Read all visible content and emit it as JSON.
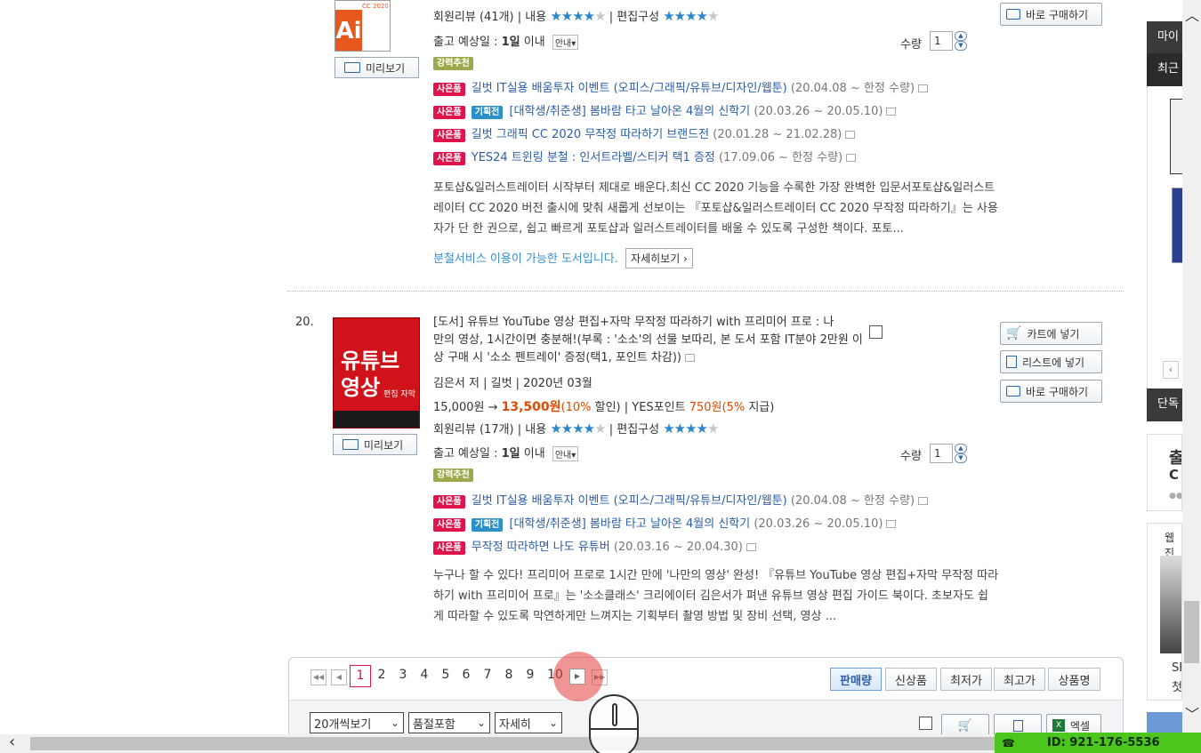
{
  "item19": {
    "review": "회원리뷰 (41개) | 내용",
    "edit_label": "| 편집구성",
    "ship": "출고 예상일 :",
    "ship_day": "1일",
    "ship_within": "이내",
    "guide": "안내▾",
    "qty_label": "수량",
    "qty_value": "1",
    "buy_now": "바로 구매하기",
    "preview": "미리보기",
    "strong": "강력추천",
    "gifts": [
      {
        "tags": [
          "사은품"
        ],
        "text": "길벗 IT실용 배움투자 이벤트 (오피스/그래픽/유튜브/디자인/웹툰)",
        "period": "(20.04.08 ~ 한정 수량)"
      },
      {
        "tags": [
          "사은품",
          "기획전"
        ],
        "text": "[대학생/취준생] 봄바람 타고 날아온 4월의 신학기",
        "period": "(20.03.26 ~ 20.05.10)"
      },
      {
        "tags": [
          "사은품"
        ],
        "text": "길벗 그래픽 CC 2020 무작정 따라하기 브랜드전",
        "period": "(20.01.28 ~ 21.02.28)"
      },
      {
        "tags": [
          "사은품"
        ],
        "text": "YES24 트윈링 분철 : 인서트라벨/스티커 택1 증정",
        "period": "(17.09.06 ~ 한정 수량)"
      }
    ],
    "desc": [
      "포토샵&일러스트레이터 시작부터 제대로 배운다.최신 CC 2020 기능을 수록한 가장 완벽한 입문서포토샵&일러스트",
      "레이터 CC 2020 버전 출시에 맞춰 새롭게 선보이는 『포토샵&일러스트레이터 CC 2020 무작정 따라하기』는 사용",
      "자가 단 한 권으로, 쉽고 빠르게 포토샵과 일러스트레이터를 배울 수 있도록 구성한 책이다. 포토..."
    ],
    "split_service": "분철서비스 이용이 가능한 도서입니다.",
    "detail": "자세히보기",
    "cover_text": "CC 2020"
  },
  "item20": {
    "rank": "20.",
    "title_line1": "[도서] 유튜브 YouTube 영상 편집+자막 무작정 따라하기 with 프리미어 프로 : 나",
    "title_line2": "만의 영상, 1시간이면 충분해!(부록 : '소소'의 선물 보따리, 본 도서 포함 IT분야 2만원 이",
    "title_line3": "상 구매 시 '소소 펜트레이' 증정(택1, 포인트 차감))",
    "author": "김은서 저 | 길벗 | 2020년 03월",
    "price_orig": "15,000원 →",
    "price_sale": "13,500원",
    "discount": "(10%",
    "discount_tail": "할인) | YES포인트",
    "points": "750원",
    "points_pct": "(5%",
    "points_tail": "지급)",
    "review": "회원리뷰 (17개) | 내용",
    "edit_label": "| 편집구성",
    "ship": "출고 예상일 :",
    "ship_day": "1일",
    "ship_within": "이내",
    "guide": "안내▾",
    "qty_label": "수량",
    "qty_value": "1",
    "cart": "카트에 넣기",
    "list": "리스트에 넣기",
    "buy_now": "바로 구매하기",
    "preview": "미리보기",
    "strong": "강력추천",
    "gifts": [
      {
        "tags": [
          "사은품"
        ],
        "text": "길벗 IT실용 배움투자 이벤트 (오피스/그래픽/유튜브/디자인/웹툰)",
        "period": "(20.04.08 ~ 한정 수량)"
      },
      {
        "tags": [
          "사은품",
          "기획전"
        ],
        "text": "[대학생/취준생] 봄바람 타고 날아온 4월의 신학기",
        "period": "(20.03.26 ~ 20.05.10)"
      },
      {
        "tags": [
          "사은품"
        ],
        "text": "무작정 따라하면 나도 유튜버",
        "period": "(20.03.16 ~ 20.04.30)"
      }
    ],
    "desc": [
      "누구나 할 수 있다! 프리미어 프로로 1시간 만에 '나만의 영상' 완성! 『유튜브 YouTube 영상 편집+자막 무작정 따라",
      "하기 with 프리미어 프로』는 '소소클래스' 크리에이터 김은서가 펴낸 유튜브 영상 편집 가이드 북이다. 초보자도 쉽",
      "게 따라할 수 있도록 막연하게만 느껴지는 기획부터 촬영 방법 및 장비 선택, 영상 ..."
    ],
    "cover_text1": "유튜브",
    "cover_text2": "영상",
    "cover_text3": "편집 자막"
  },
  "pagination": {
    "pages": [
      "1",
      "2",
      "3",
      "4",
      "5",
      "6",
      "7",
      "8",
      "9",
      "10"
    ],
    "current": "1"
  },
  "sort": [
    "판매량",
    "신상품",
    "최저가",
    "최고가",
    "상품명"
  ],
  "bottom": {
    "per_page": "20개씩보기",
    "soldout": "품절포함",
    "view": "자세히",
    "excel": "엑셀"
  },
  "right_panel": {
    "tab1": "마이",
    "tab2": "최근",
    "tab3": "단독",
    "box1_a": "출",
    "box1_b": "C",
    "box2_title": "웹진",
    "box2_a": "SF",
    "box2_b": "첫"
  },
  "status_bar": {
    "id": "ID: 921-176-5536"
  },
  "colors": {
    "link": "#2a5ea8",
    "sale": "#e04a00",
    "tag_red": "#e0144c",
    "tag_blue": "#2b90c8",
    "star": "#2a86c8",
    "status_green": "#4cc51c"
  }
}
